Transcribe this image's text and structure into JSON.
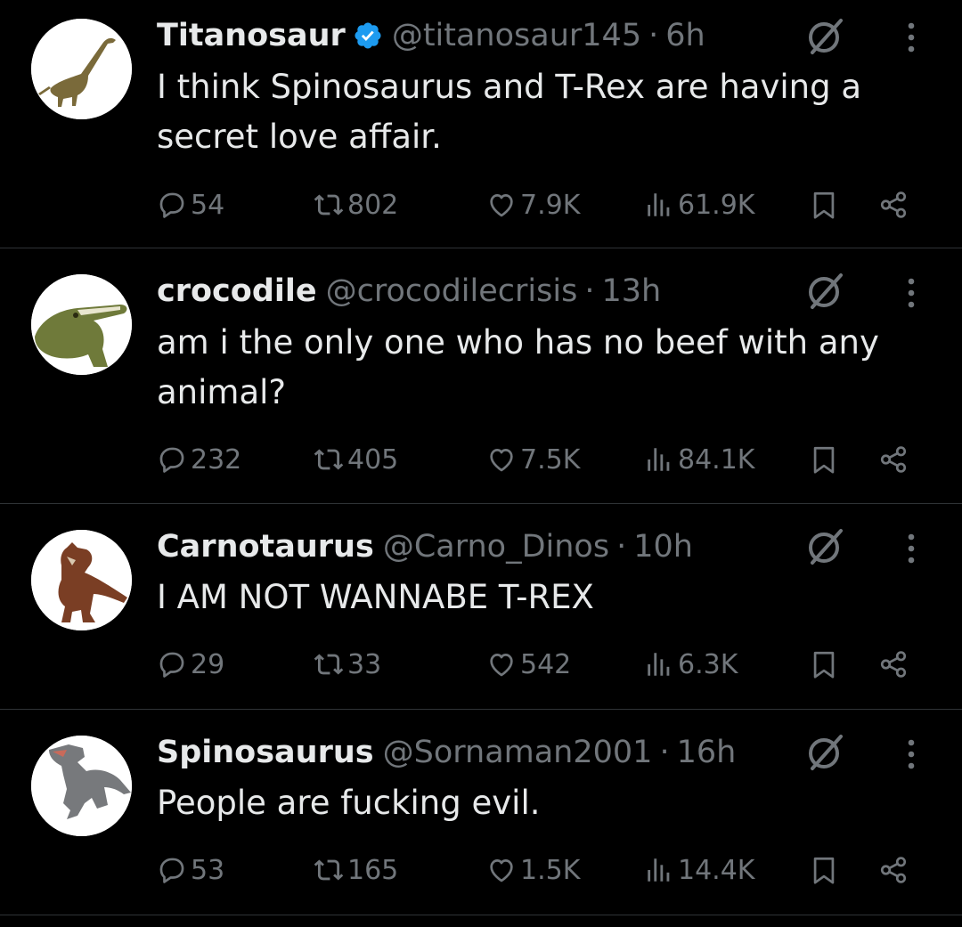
{
  "colors": {
    "background": "#000000",
    "text": "#e7e9ea",
    "muted": "#71767b",
    "divider": "#2f3336",
    "verified": "#1d9bf0"
  },
  "icons": {
    "reply": "speech-bubble-icon",
    "retweet": "retweet-arrows-icon",
    "like": "heart-icon",
    "views": "bar-chart-icon",
    "bookmark": "bookmark-icon",
    "share": "share-nodes-icon",
    "grok": "grok-slash-circle-icon",
    "more": "vertical-dots-icon",
    "verified": "verified-badge-icon"
  },
  "tweets": [
    {
      "name": "Titanosaur",
      "verified": true,
      "handle": "@titanosaur145",
      "separator": "·",
      "time": "6h",
      "text_lines": [
        "I think Spinosaurus and T-Rex are having a",
        "secret love affair."
      ],
      "replies": "54",
      "reposts": "802",
      "likes": "7.9K",
      "views": "61.9K"
    },
    {
      "name": "crocodile",
      "verified": false,
      "handle": "@crocodilecrisis",
      "separator": "·",
      "time": "13h",
      "text_lines": [
        "am i the only one who has no beef with any",
        "animal?"
      ],
      "replies": "232",
      "reposts": "405",
      "likes": "7.5K",
      "views": "84.1K"
    },
    {
      "name": "Carnotaurus",
      "verified": false,
      "handle": "@Carno_Dinos",
      "separator": "·",
      "time": "10h",
      "text_lines": [
        "I AM NOT WANNABE T-REX"
      ],
      "replies": "29",
      "reposts": "33",
      "likes": "542",
      "views": "6.3K"
    },
    {
      "name": "Spinosaurus",
      "verified": false,
      "handle": "@Sornaman2001",
      "separator": "·",
      "time": "16h",
      "text_lines": [
        "People are fucking evil."
      ],
      "replies": "53",
      "reposts": "165",
      "likes": "1.5K",
      "views": "14.4K"
    }
  ]
}
